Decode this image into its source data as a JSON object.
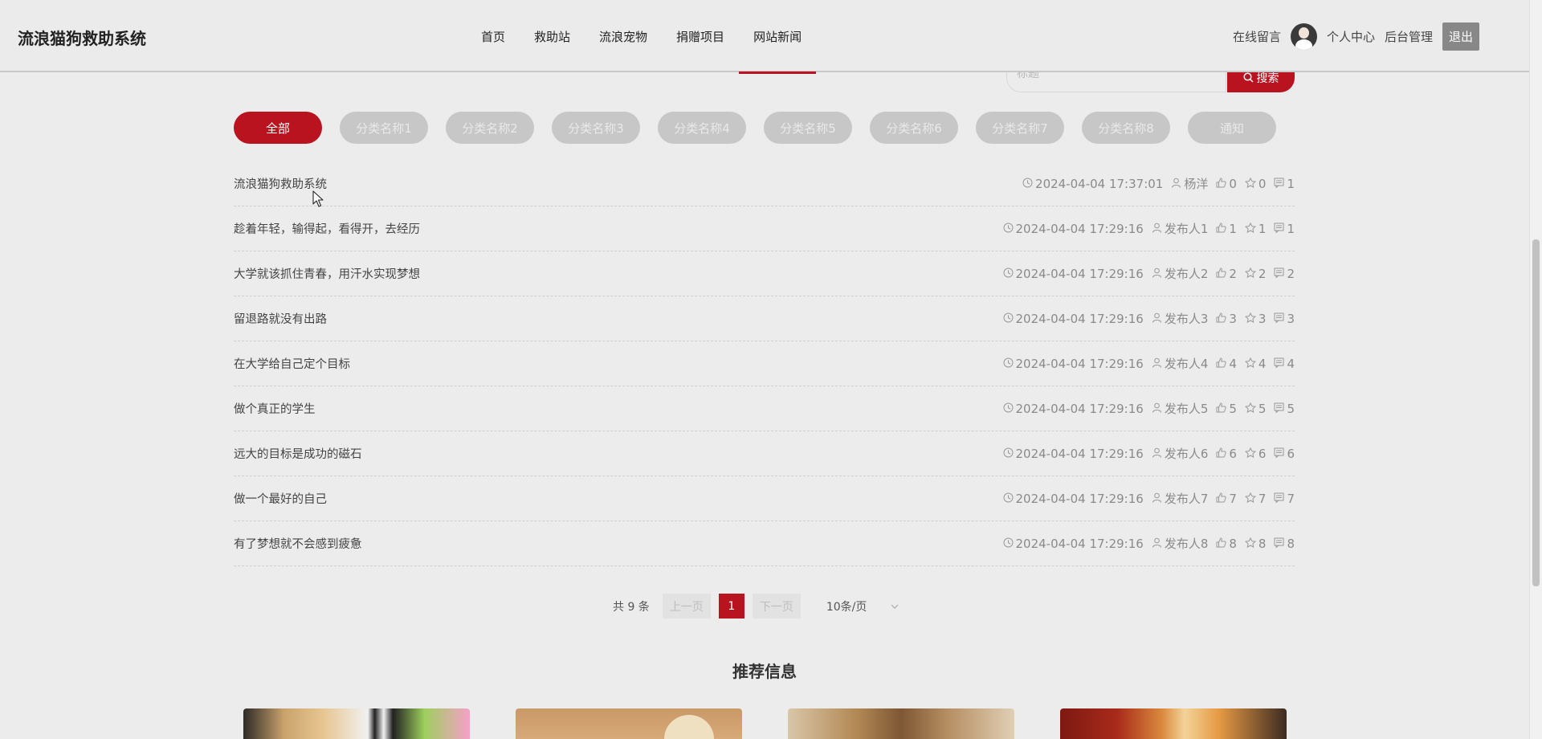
{
  "header": {
    "site_title": "流浪猫狗救助系统",
    "nav": [
      {
        "label": "首页",
        "active": false
      },
      {
        "label": "救助站",
        "active": false
      },
      {
        "label": "流浪宠物",
        "active": false
      },
      {
        "label": "捐赠项目",
        "active": false
      },
      {
        "label": "网站新闻",
        "active": true
      }
    ],
    "message_label": "在线留言",
    "user_center_label": "个人中心",
    "admin_label": "后台管理",
    "logout_label": "退出"
  },
  "search": {
    "placeholder": "标题",
    "button_label": "搜索"
  },
  "categories": [
    {
      "label": "全部",
      "active": true
    },
    {
      "label": "分类名称1",
      "active": false
    },
    {
      "label": "分类名称2",
      "active": false
    },
    {
      "label": "分类名称3",
      "active": false
    },
    {
      "label": "分类名称4",
      "active": false
    },
    {
      "label": "分类名称5",
      "active": false
    },
    {
      "label": "分类名称6",
      "active": false
    },
    {
      "label": "分类名称7",
      "active": false
    },
    {
      "label": "分类名称8",
      "active": false
    },
    {
      "label": "通知",
      "active": false
    }
  ],
  "news": [
    {
      "title": "流浪猫狗救助系统",
      "time": "2024-04-04 17:37:01",
      "author": "杨洋",
      "likes": "0",
      "favorites": "0",
      "comments": "1"
    },
    {
      "title": "趁着年轻，输得起，看得开，去经历",
      "time": "2024-04-04 17:29:16",
      "author": "发布人1",
      "likes": "1",
      "favorites": "1",
      "comments": "1"
    },
    {
      "title": "大学就该抓住青春，用汗水实现梦想",
      "time": "2024-04-04 17:29:16",
      "author": "发布人2",
      "likes": "2",
      "favorites": "2",
      "comments": "2"
    },
    {
      "title": "留退路就没有出路",
      "time": "2024-04-04 17:29:16",
      "author": "发布人3",
      "likes": "3",
      "favorites": "3",
      "comments": "3"
    },
    {
      "title": "在大学给自己定个目标",
      "time": "2024-04-04 17:29:16",
      "author": "发布人4",
      "likes": "4",
      "favorites": "4",
      "comments": "4"
    },
    {
      "title": "做个真正的学生",
      "time": "2024-04-04 17:29:16",
      "author": "发布人5",
      "likes": "5",
      "favorites": "5",
      "comments": "5"
    },
    {
      "title": "远大的目标是成功的磁石",
      "time": "2024-04-04 17:29:16",
      "author": "发布人6",
      "likes": "6",
      "favorites": "6",
      "comments": "6"
    },
    {
      "title": "做一个最好的自己",
      "time": "2024-04-04 17:29:16",
      "author": "发布人7",
      "likes": "7",
      "favorites": "7",
      "comments": "7"
    },
    {
      "title": "有了梦想就不会感到疲惫",
      "time": "2024-04-04 17:29:16",
      "author": "发布人8",
      "likes": "8",
      "favorites": "8",
      "comments": "8"
    }
  ],
  "pagination": {
    "total": "共 9 条",
    "prev_label": "上一页",
    "current_page": "1",
    "next_label": "下一页",
    "page_size": "10条/页"
  },
  "recommend": {
    "title": "推荐信息"
  },
  "colors": {
    "accent": "#b8131f",
    "category_inactive": "#c7c7c7",
    "background": "#ececec"
  },
  "icons": [
    "search-icon",
    "clock-icon",
    "user-icon",
    "thumbs-up-icon",
    "star-icon",
    "comment-icon",
    "chevron-down-icon",
    "avatar"
  ]
}
